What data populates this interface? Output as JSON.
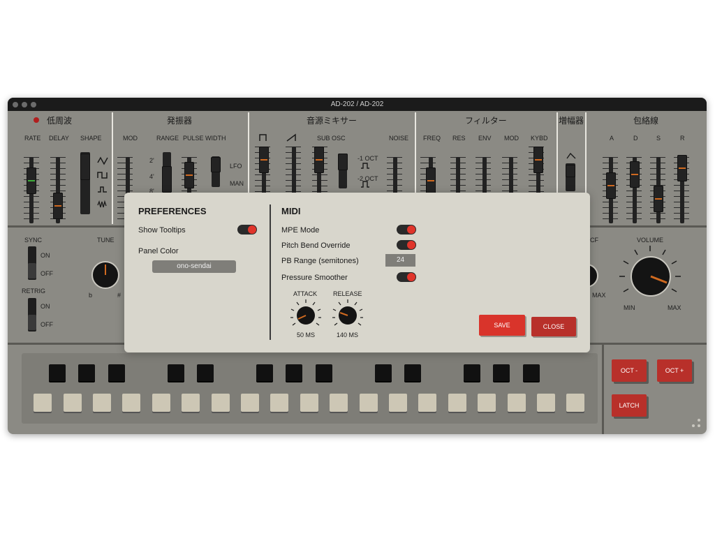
{
  "window": {
    "title": "AD-202 / AD-202"
  },
  "sections": {
    "lfo": "低周波",
    "vco": "発振器",
    "mixer": "音源ミキサー",
    "filter": "フィルター",
    "vca": "増幅器",
    "envelope": "包絡線"
  },
  "labels": {
    "rate": "RATE",
    "delay": "DELAY",
    "shape": "SHAPE",
    "mod": "MOD",
    "range": "RANGE",
    "pulse_width": "PULSE WIDTH",
    "lfo": "LFO",
    "man": "MAN",
    "range_marks": [
      "2'",
      "4'",
      "8'"
    ],
    "sub_osc": "SUB OSC",
    "noise": "NOISE",
    "oct1": "-1 OCT",
    "oct2": "-2 OCT",
    "freq": "FREQ",
    "res": "RES",
    "env": "ENV",
    "filt_mod": "MOD",
    "kybd": "KYBD",
    "a": "A",
    "d": "D",
    "s": "S",
    "r": "R",
    "sync": "SYNC",
    "retrig": "RETRIG",
    "on": "ON",
    "off": "OFF",
    "tune": "TUNE",
    "flat": "b",
    "sharp": "#",
    "cf": "CF",
    "max": "MAX",
    "volume": "VOLUME",
    "min": "MIN",
    "vol_max": "MAX"
  },
  "keyboard_buttons": {
    "oct_down": "OCT -",
    "oct_up": "OCT +",
    "latch": "LATCH"
  },
  "preferences": {
    "heading": "PREFERENCES",
    "show_tooltips": {
      "label": "Show Tooltips",
      "on": true
    },
    "panel_color": {
      "label": "Panel Color",
      "value": "ono-sendai"
    }
  },
  "midi": {
    "heading": "MIDI",
    "mpe_mode": {
      "label": "MPE Mode",
      "on": true
    },
    "pitch_bend_override": {
      "label": "Pitch Bend Override",
      "on": true
    },
    "pb_range": {
      "label": "PB Range (semitones)",
      "value": "24"
    },
    "pressure_smoother": {
      "label": "Pressure Smoother",
      "on": true
    },
    "attack": {
      "label": "ATTACK",
      "value": "50 MS"
    },
    "release": {
      "label": "RELEASE",
      "value": "140 MS"
    }
  },
  "dialog_buttons": {
    "save": "SAVE",
    "close": "CLOSE"
  },
  "colors": {
    "accent_red": "#d9342b",
    "panel": "#8b8a84",
    "overlay": "#d8d6cc",
    "slider_stripe": "#d06a20",
    "lfo_stripe": "#3fae3a"
  }
}
